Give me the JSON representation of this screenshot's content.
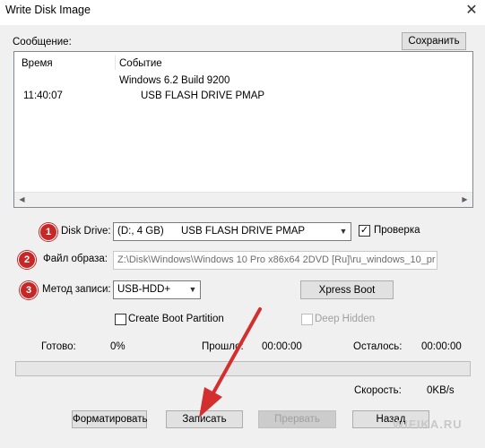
{
  "window": {
    "title": "Write Disk Image"
  },
  "message": {
    "label": "Сообщение:",
    "save_button": "Сохранить",
    "columns": {
      "time": "Время",
      "event": "Событие"
    },
    "rows": [
      {
        "time": "",
        "event": "Windows 6.2 Build 9200"
      },
      {
        "time": "11:40:07",
        "event": "USB FLASH DRIVE PMAP"
      }
    ]
  },
  "disk_drive": {
    "badge": "1",
    "label": "Disk Drive:",
    "letter": "(D:, 4 GB)",
    "name": "USB FLASH DRIVE PMAP"
  },
  "verify": {
    "label": "Проверка",
    "checked": "✓"
  },
  "image_file": {
    "badge": "2",
    "label": "Файл образа:",
    "value": "Z:\\Disk\\Windows\\Windows 10 Pro x86x64 2DVD [Ru]\\ru_windows_10_pr"
  },
  "write_method": {
    "badge": "3",
    "label": "Метод записи:",
    "value": "USB-HDD+"
  },
  "xpress_boot": "Xpress Boot",
  "create_boot": {
    "label": "Create Boot Partition"
  },
  "deep_hidden": {
    "label": "Deep Hidden"
  },
  "status": {
    "done_label": "Готово:",
    "done_value": "0%",
    "elapsed_label": "Прошло:",
    "elapsed_value": "00:00:00",
    "remaining_label": "Осталось:",
    "remaining_value": "00:00:00",
    "speed_label": "Скорость:",
    "speed_value": "0KB/s",
    "progress": 0
  },
  "buttons": {
    "format": "Форматировать",
    "write": "Записать",
    "abort": "Прервать",
    "back": "Назад"
  },
  "watermark": "WIFIKA.RU",
  "colors": {
    "badge": "#c62828",
    "arrow": "#d32f2f",
    "background": "#f0f0f0"
  },
  "icons": {
    "close": "close-icon",
    "dropdown": "chevron-down-icon",
    "scroll_left": "scroll-left-icon",
    "scroll_right": "scroll-right-icon"
  }
}
